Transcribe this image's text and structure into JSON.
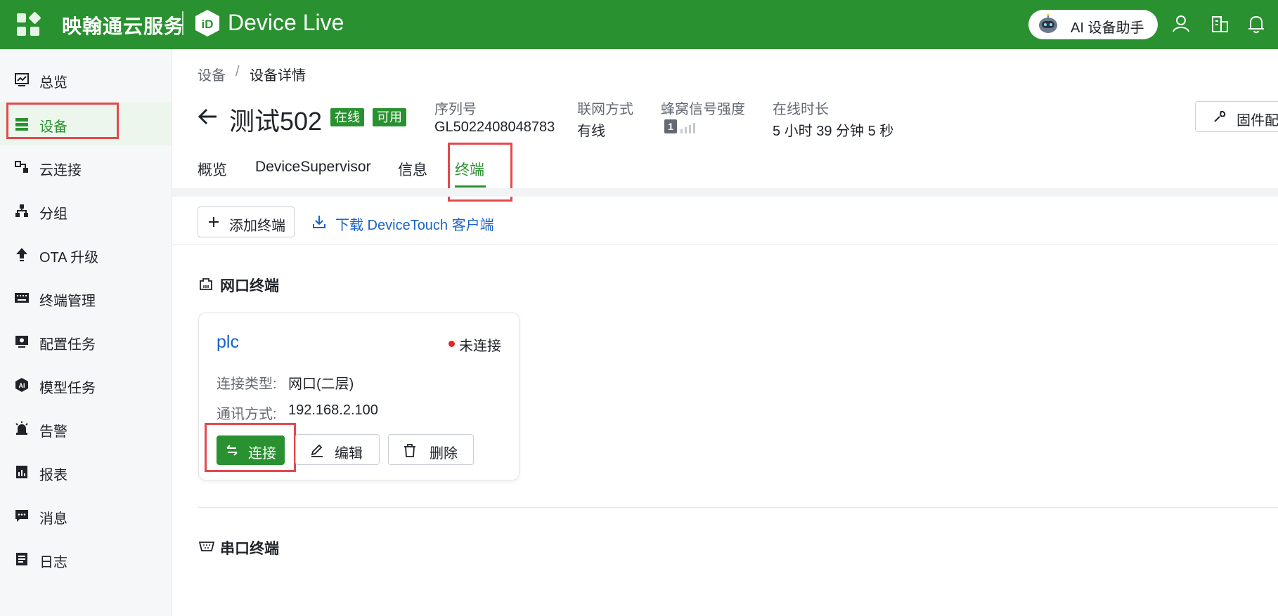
{
  "header": {
    "brand": "映翰通云服务",
    "product": "Device Live",
    "ai_assistant": "AI 设备助手",
    "color": "#2a9130"
  },
  "sidebar": {
    "items": [
      {
        "label": "总览",
        "icon": "dashboard-icon"
      },
      {
        "label": "设备",
        "icon": "device-list-icon"
      },
      {
        "label": "云连接",
        "icon": "cloud-connect-icon"
      },
      {
        "label": "分组",
        "icon": "group-icon"
      },
      {
        "label": "OTA 升级",
        "icon": "upload-icon"
      },
      {
        "label": "终端管理",
        "icon": "keyboard-icon"
      },
      {
        "label": "配置任务",
        "icon": "config-task-icon"
      },
      {
        "label": "模型任务",
        "icon": "ai-model-icon"
      },
      {
        "label": "告警",
        "icon": "alarm-icon"
      },
      {
        "label": "报表",
        "icon": "report-icon"
      },
      {
        "label": "消息",
        "icon": "message-icon"
      },
      {
        "label": "日志",
        "icon": "log-icon"
      }
    ],
    "active": "设备"
  },
  "breadcrumb": {
    "root": "设备",
    "separator": "/",
    "current": "设备详情"
  },
  "device": {
    "name": "测试502",
    "badges": [
      "在线",
      "可用"
    ],
    "serial_label": "序列号",
    "serial_value": "GL5022408048783",
    "network_label": "联网方式",
    "network_value": "有线",
    "signal_label": "蜂窝信号强度",
    "signal_sim": "1",
    "uptime_label": "在线时长",
    "uptime_value": "5 小时 39 分钟 5 秒",
    "firmware_button": "固件配"
  },
  "tabs": [
    "概览",
    "DeviceSupervisor",
    "信息",
    "终端"
  ],
  "active_tab": "终端",
  "toolbar": {
    "add_label": "添加终端",
    "download_label": "下载 DeviceTouch 客户端"
  },
  "ethernet_section": {
    "title": "网口终端",
    "card": {
      "name": "plc",
      "status": "未连接",
      "status_color": "#e5242a",
      "conn_type_label": "连接类型:",
      "conn_type_value": "网口(二层)",
      "comm_label": "通讯方式:",
      "comm_value": "192.168.2.100",
      "connect_label": "连接",
      "edit_label": "编辑",
      "delete_label": "删除"
    }
  },
  "serial_section": {
    "title": "串口终端"
  }
}
